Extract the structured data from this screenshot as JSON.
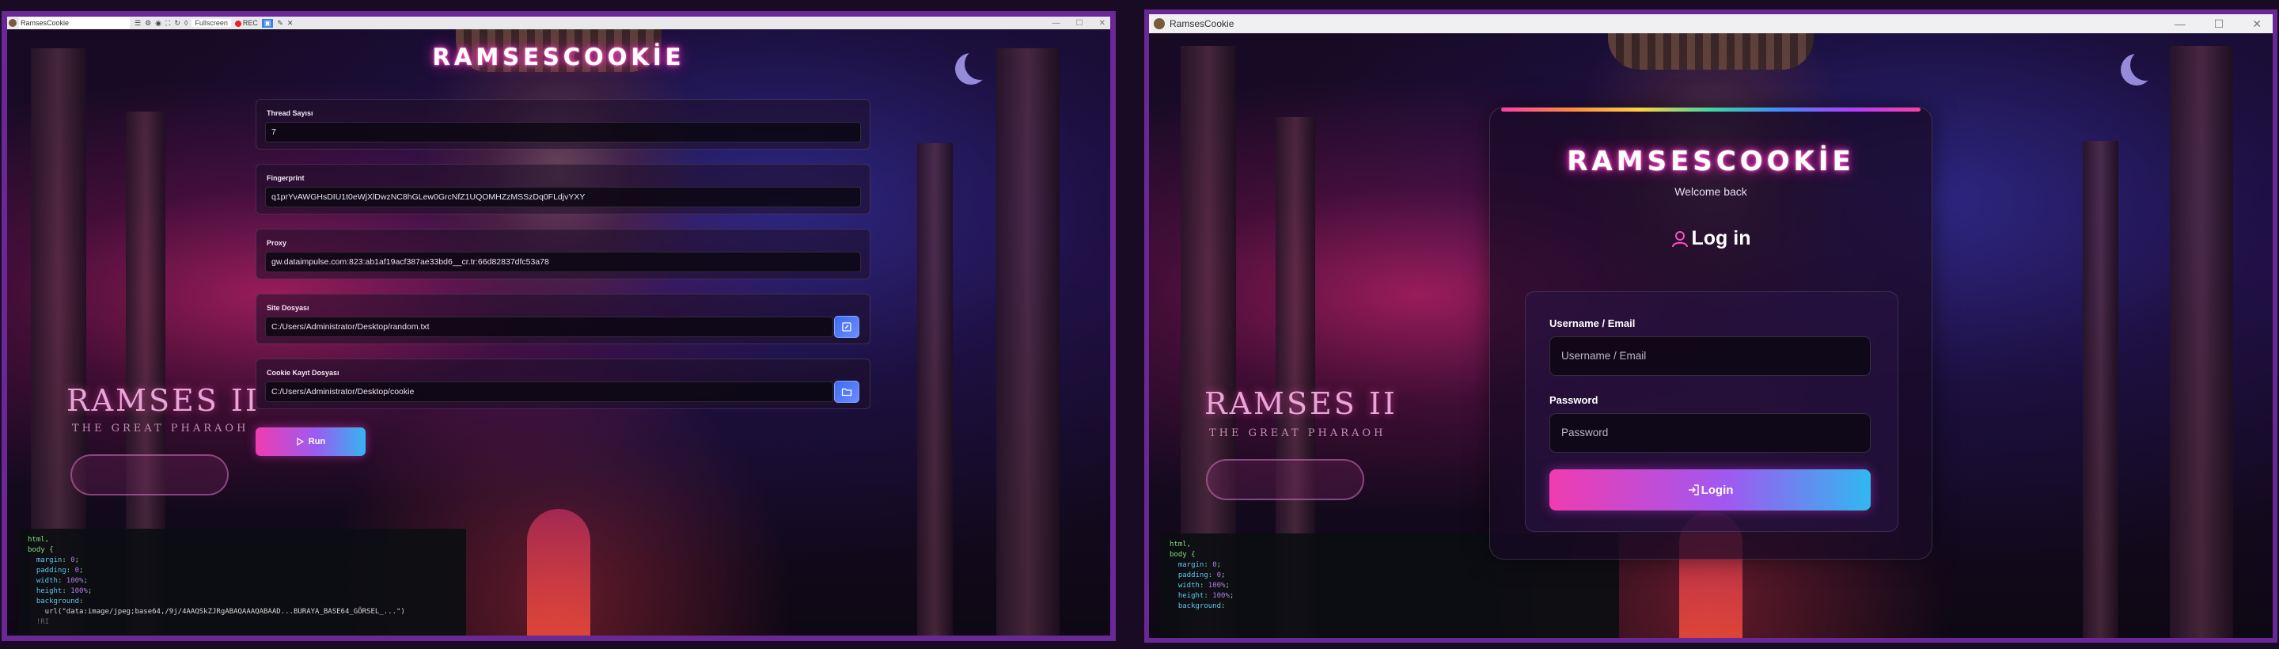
{
  "left_window": {
    "title": "RamsesCookie",
    "toolbar": {
      "fullscreen_label": "Fullscreen",
      "rec_label": "REC"
    },
    "brand": "RAMSESCOOKİE",
    "background": {
      "ramses_title": "RAMSES II",
      "ramses_subtitle": "THE GREAT PHARAOH"
    },
    "fields": {
      "thread": {
        "label": "Thread Sayısı",
        "value": "7"
      },
      "fingerprint": {
        "label": "Fingerprint",
        "value": "q1prYvAWGHsDIU1t0eWjXlDwzNC8hGLew0GrcNfZ1UQOMHZzMSSzDq0FLdjvYXY"
      },
      "proxy": {
        "label": "Proxy",
        "value": "gw.dataimpulse.com:823:ab1af19acf387ae33bd6__cr.tr:66d82837dfc53a78"
      },
      "site_file": {
        "label": "Site Dosyası",
        "value": "C:/Users/Administrator/Desktop/random.txt"
      },
      "cookie_dir": {
        "label": "Cookie Kayıt Dosyası",
        "value": "C:/Users/Administrator/Desktop/cookie"
      }
    },
    "run_label": "Run",
    "code": {
      "l1": "html,",
      "l2": "body {",
      "l3a": "  margin",
      "l3b": "0",
      "l4a": "  padding",
      "l4b": "0",
      "l5a": "  width",
      "l5b": "100%",
      "l6a": "  height",
      "l6b": "100%",
      "l7a": "  background",
      "l8": "    url(\"data:image/jpeg;base64,/9j/4AAQSkZJRgABAQAAAQABAAD...BURAYA_BASE64_GÖRSEL_...\")",
      "l9": "  !RI"
    }
  },
  "right_window": {
    "title": "RamsesCookie",
    "brand": "RAMSESCOOKİE",
    "welcome": "Welcome back",
    "heading": "Log in",
    "background": {
      "ramses_title": "RAMSES II",
      "ramses_subtitle": "THE GREAT PHARAOH"
    },
    "username": {
      "label": "Username / Email",
      "placeholder": "Username / Email"
    },
    "password": {
      "label": "Password",
      "placeholder": "Password"
    },
    "login_label": "Login",
    "code": {
      "l1": "html,",
      "l2": "body {",
      "l3a": "  margin",
      "l3b": "0",
      "l4a": "  padding",
      "l4b": "0",
      "l5a": "  width",
      "l5b": "100%",
      "l6a": "  height",
      "l6b": "100%",
      "l7a": "  background"
    }
  },
  "colors": {
    "window_border": "#6a2796",
    "accent_pink": "#f03cb0",
    "accent_blue": "#30b8f0",
    "brand_glow": "#ff3dc8"
  }
}
